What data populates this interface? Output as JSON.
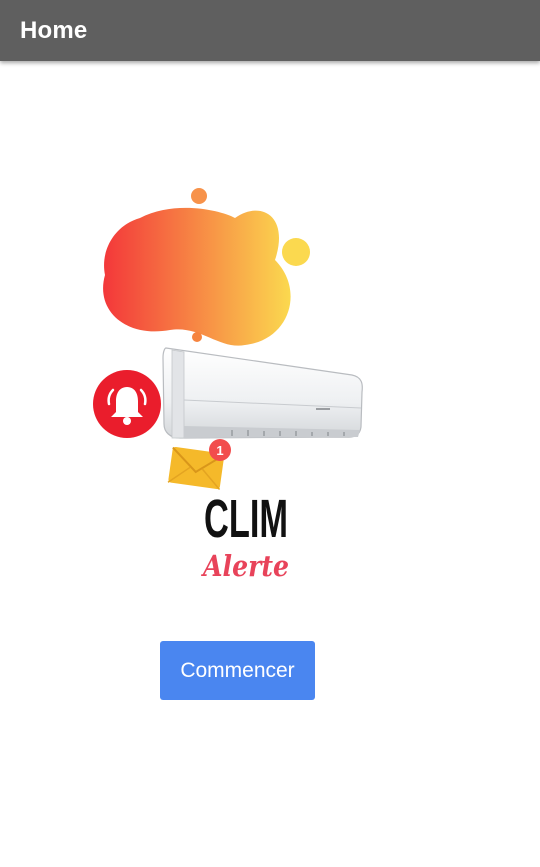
{
  "header": {
    "title": "Home"
  },
  "logo": {
    "word_top": "CLIM",
    "word_bottom": "Alerte",
    "badge_count": "1",
    "colors": {
      "blob_start": "#f3373a",
      "blob_end": "#fbd94f",
      "bell_bg": "#ea1d2c",
      "envelope": "#f5b92a",
      "badge": "#f24d4d",
      "alerte_text": "#e8435a"
    }
  },
  "actions": {
    "start_label": "Commencer"
  },
  "theme": {
    "app_bar": "#5f5f5f",
    "primary_button": "#4a86f0"
  }
}
